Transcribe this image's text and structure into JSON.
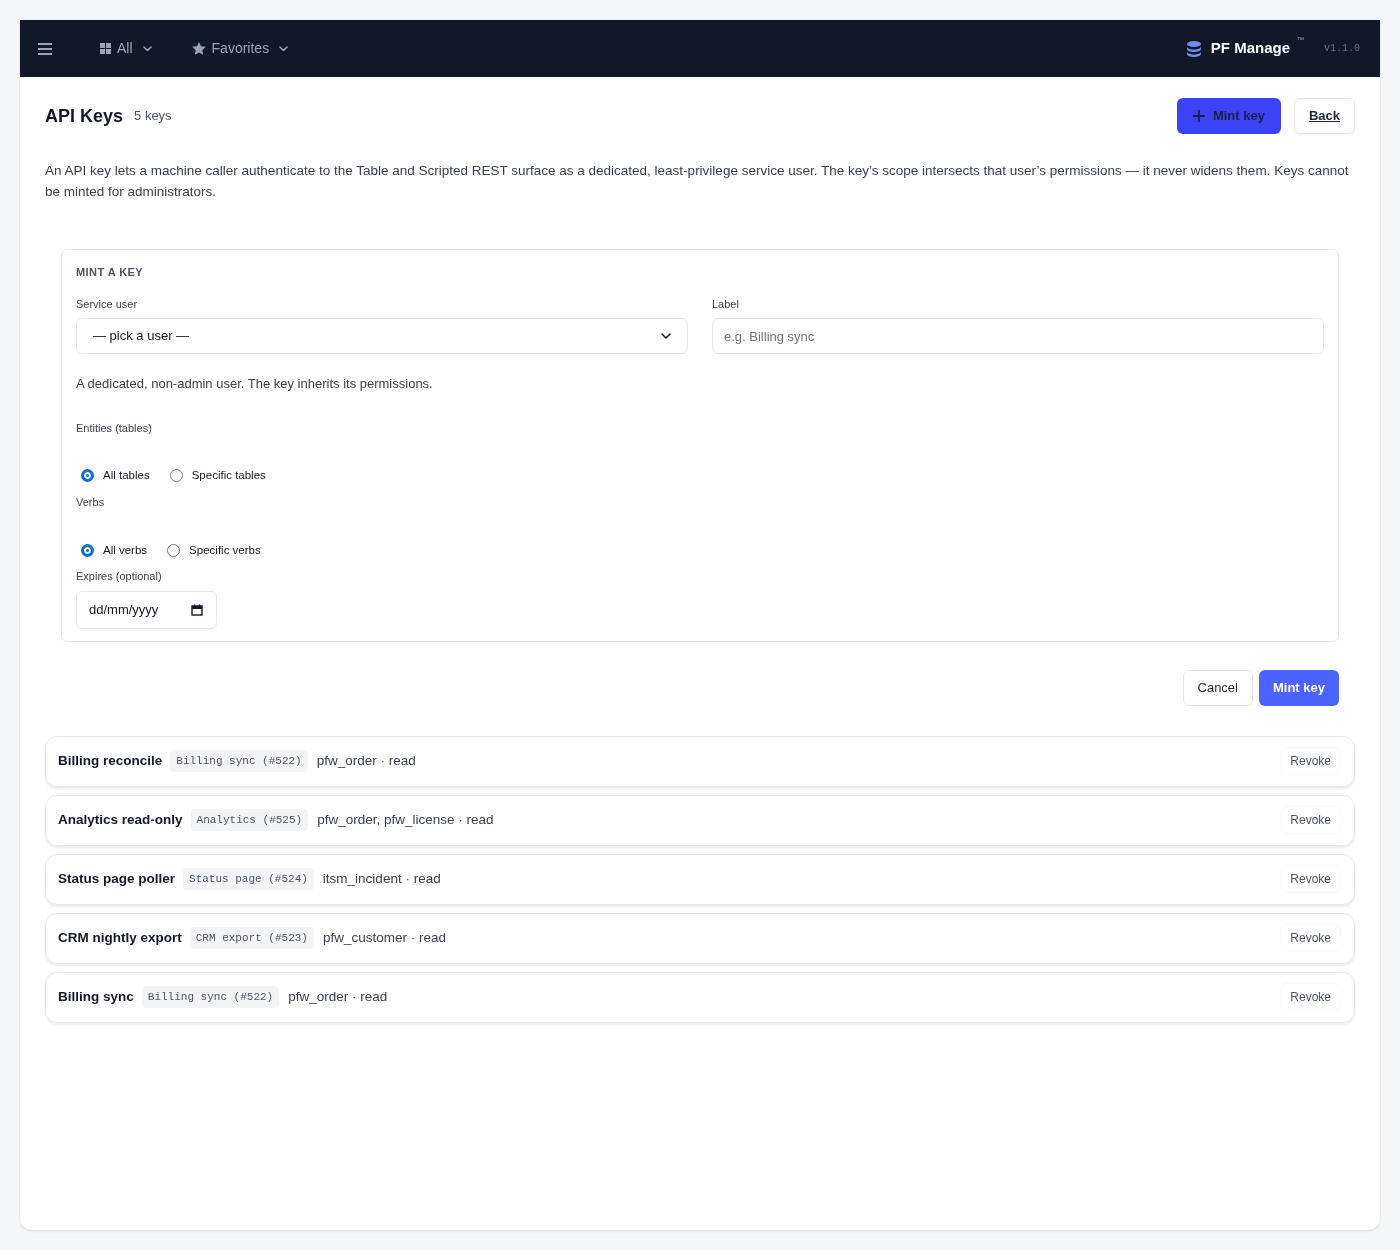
{
  "navbar": {
    "menus": [
      {
        "label": "All"
      },
      {
        "label": "Favorites"
      }
    ],
    "brand": {
      "name": "PF Manage",
      "mark": "™",
      "version": "v1.1.0"
    }
  },
  "header": {
    "title": "API Keys",
    "count": "5 keys",
    "mint_button": "Mint key",
    "back_button": "Back"
  },
  "description": "An API key lets a machine caller authenticate to the Table and Scripted REST surface as a dedicated, least-privilege service user. The key’s scope intersects that user’s permissions — it never widens them. Keys cannot be minted for administrators.",
  "form": {
    "heading": "MINT A KEY",
    "service_user": {
      "label": "Service user",
      "value": "— pick a user —"
    },
    "label_field": {
      "label": "Label",
      "placeholder": "e.g. Billing sync"
    },
    "help": "A dedicated, non-admin user. The key inherits its permissions.",
    "groups": [
      {
        "label": "Entities (tables)",
        "options": [
          {
            "label": "All tables",
            "selected": true
          },
          {
            "label": "Specific tables",
            "selected": false
          }
        ]
      },
      {
        "label": "Verbs",
        "options": [
          {
            "label": "All verbs",
            "selected": true
          },
          {
            "label": "Specific verbs",
            "selected": false
          }
        ]
      }
    ],
    "expires": {
      "label": "Expires (optional)",
      "placeholder": "dd/mm/yyyy"
    },
    "cancel_button": "Cancel",
    "submit_button": "Mint key"
  },
  "keys": [
    {
      "name": "Billing reconcile",
      "user": "Billing sync (#522)",
      "scope": "pfw_order · read",
      "action": "Revoke"
    },
    {
      "name": "Analytics read-only",
      "user": "Analytics (#525)",
      "scope": "pfw_order, pfw_license · read",
      "action": "Revoke"
    },
    {
      "name": "Status page poller",
      "user": "Status page (#524)",
      "scope": "itsm_incident · read",
      "action": "Revoke"
    },
    {
      "name": "CRM nightly export",
      "user": "CRM export (#523)",
      "scope": "pfw_customer · read",
      "action": "Revoke"
    },
    {
      "name": "Billing sync",
      "user": "Billing sync (#522)",
      "scope": "pfw_order · read",
      "action": "Revoke"
    }
  ]
}
